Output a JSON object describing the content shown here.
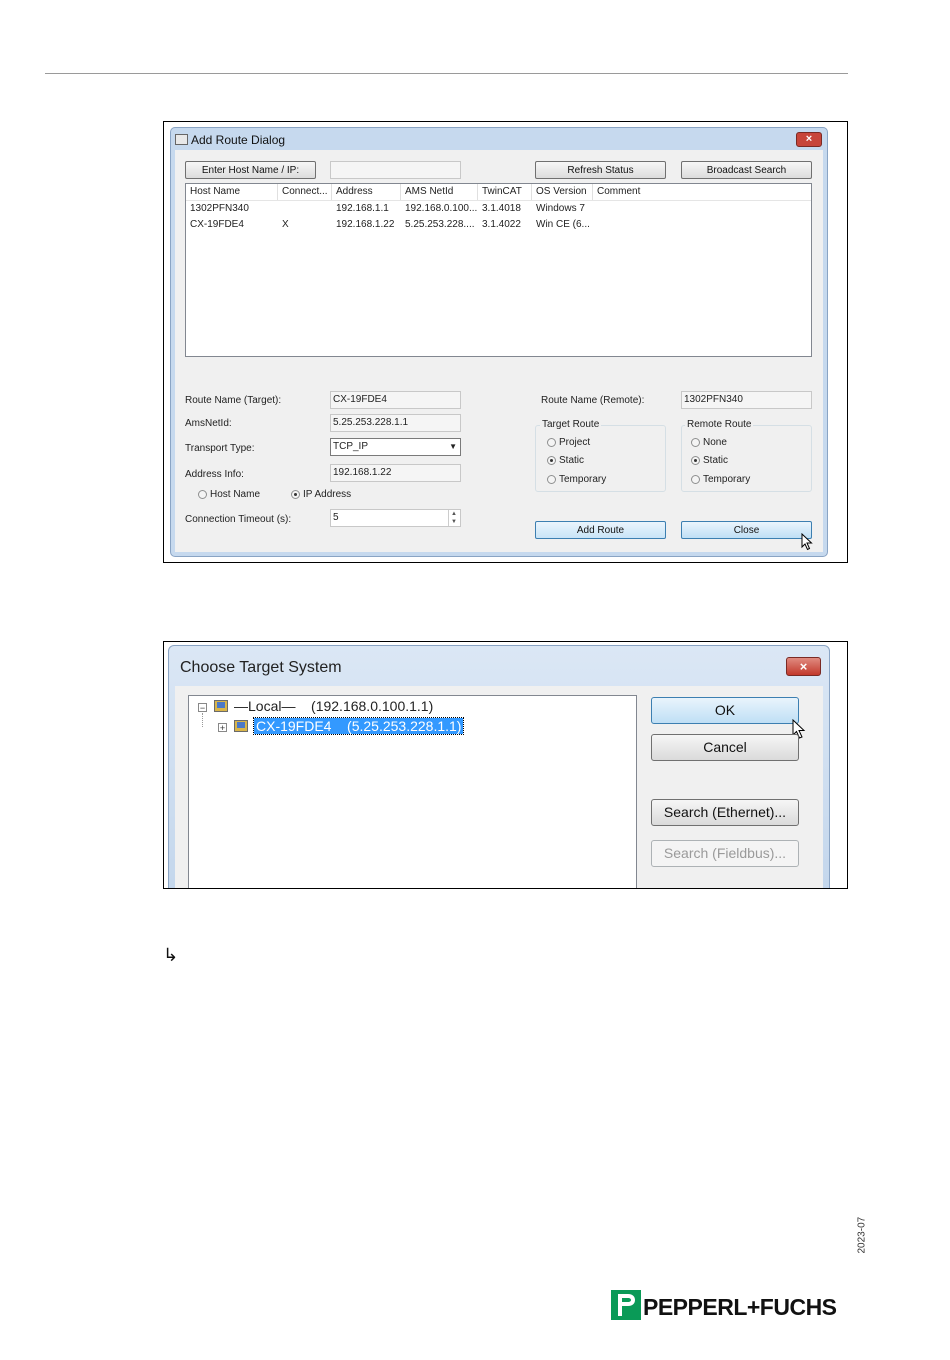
{
  "add_route_dialog": {
    "title": "Add Route Dialog",
    "buttons": {
      "enter_host": "Enter Host Name / IP:",
      "refresh": "Refresh Status",
      "broadcast": "Broadcast Search",
      "add_route": "Add Route",
      "close": "Close"
    },
    "columns": [
      "Host Name",
      "Connect...",
      "Address",
      "AMS NetId",
      "TwinCAT",
      "OS Version",
      "Comment"
    ],
    "rows": [
      [
        "1302PFN340",
        "",
        "192.168.1.1",
        "192.168.0.100...",
        "3.1.4018",
        "Windows 7",
        ""
      ],
      [
        "CX-19FDE4",
        "X",
        "192.168.1.22",
        "5.25.253.228....",
        "3.1.4022",
        "Win CE (6...",
        ""
      ]
    ],
    "labels": {
      "route_name_target": "Route Name (Target):",
      "ams_netid": "AmsNetId:",
      "transport_type": "Transport Type:",
      "address_info": "Address Info:",
      "host_name": "Host Name",
      "ip_address": "IP Address",
      "connection_timeout": "Connection Timeout (s):",
      "route_name_remote": "Route Name (Remote):",
      "target_route": "Target Route",
      "remote_route": "Remote Route"
    },
    "values": {
      "route_name_target": "CX-19FDE4",
      "ams_netid": "5.25.253.228.1.1",
      "transport_type": "TCP_IP",
      "address_info": "192.168.1.22",
      "connection_timeout": "5",
      "route_name_remote": "1302PFN340"
    },
    "target_route_options": [
      "Project",
      "Static",
      "Temporary"
    ],
    "remote_route_options": [
      "None",
      "Static",
      "Temporary"
    ],
    "selected": {
      "address_mode": "IP Address",
      "target_route": "Static",
      "remote_route": "Static"
    }
  },
  "choose_target_dialog": {
    "title": "Choose Target System",
    "tree": {
      "root_label": "—Local—",
      "root_address": "(192.168.0.100.1.1)",
      "child_label": "CX-19FDE4",
      "child_address": "(5.25.253.228.1.1)"
    },
    "buttons": {
      "ok": "OK",
      "cancel": "Cancel",
      "search_ethernet": "Search (Ethernet)...",
      "search_fieldbus": "Search (Fieldbus)..."
    }
  },
  "page": {
    "result_arrow": "↳",
    "date_code": "2023-07",
    "logo_text": "PEPPERL+FUCHS"
  }
}
